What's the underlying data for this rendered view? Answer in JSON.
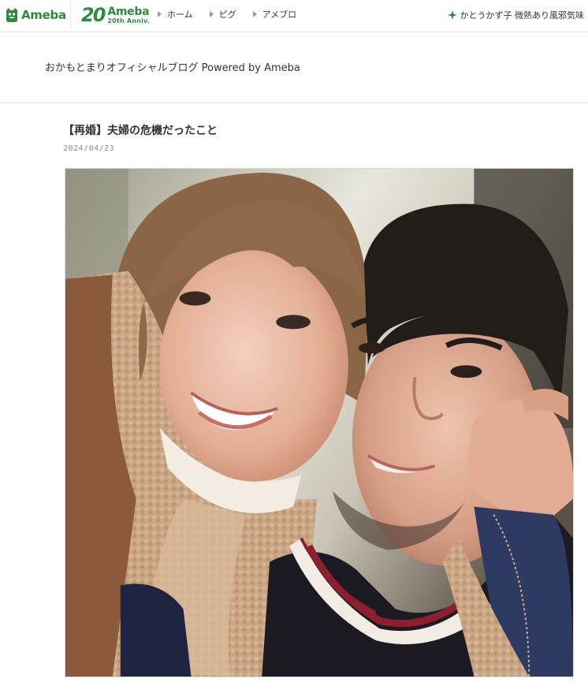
{
  "global_nav": {
    "logo_text": "Ameba",
    "anniversary": {
      "number": "20",
      "brand": "Ameba",
      "sub": "20th Anniv."
    },
    "links": [
      {
        "label": "ホーム"
      },
      {
        "label": "ピグ"
      },
      {
        "label": "アメブロ"
      }
    ],
    "trending": {
      "icon": "clover-icon",
      "text": "かとうかず子 微熱あり風邪気味"
    },
    "colors": {
      "brand": "#2d8c3c"
    }
  },
  "blog": {
    "title": "おかもとまりオフィシャルブログ Powered by Ameba"
  },
  "entry": {
    "title": "【再婚】夫婦の危機だったこと",
    "date": "2024/04/23",
    "photo": {
      "kind": "selfie photo of a smiling couple, cheek to cheek"
    }
  }
}
